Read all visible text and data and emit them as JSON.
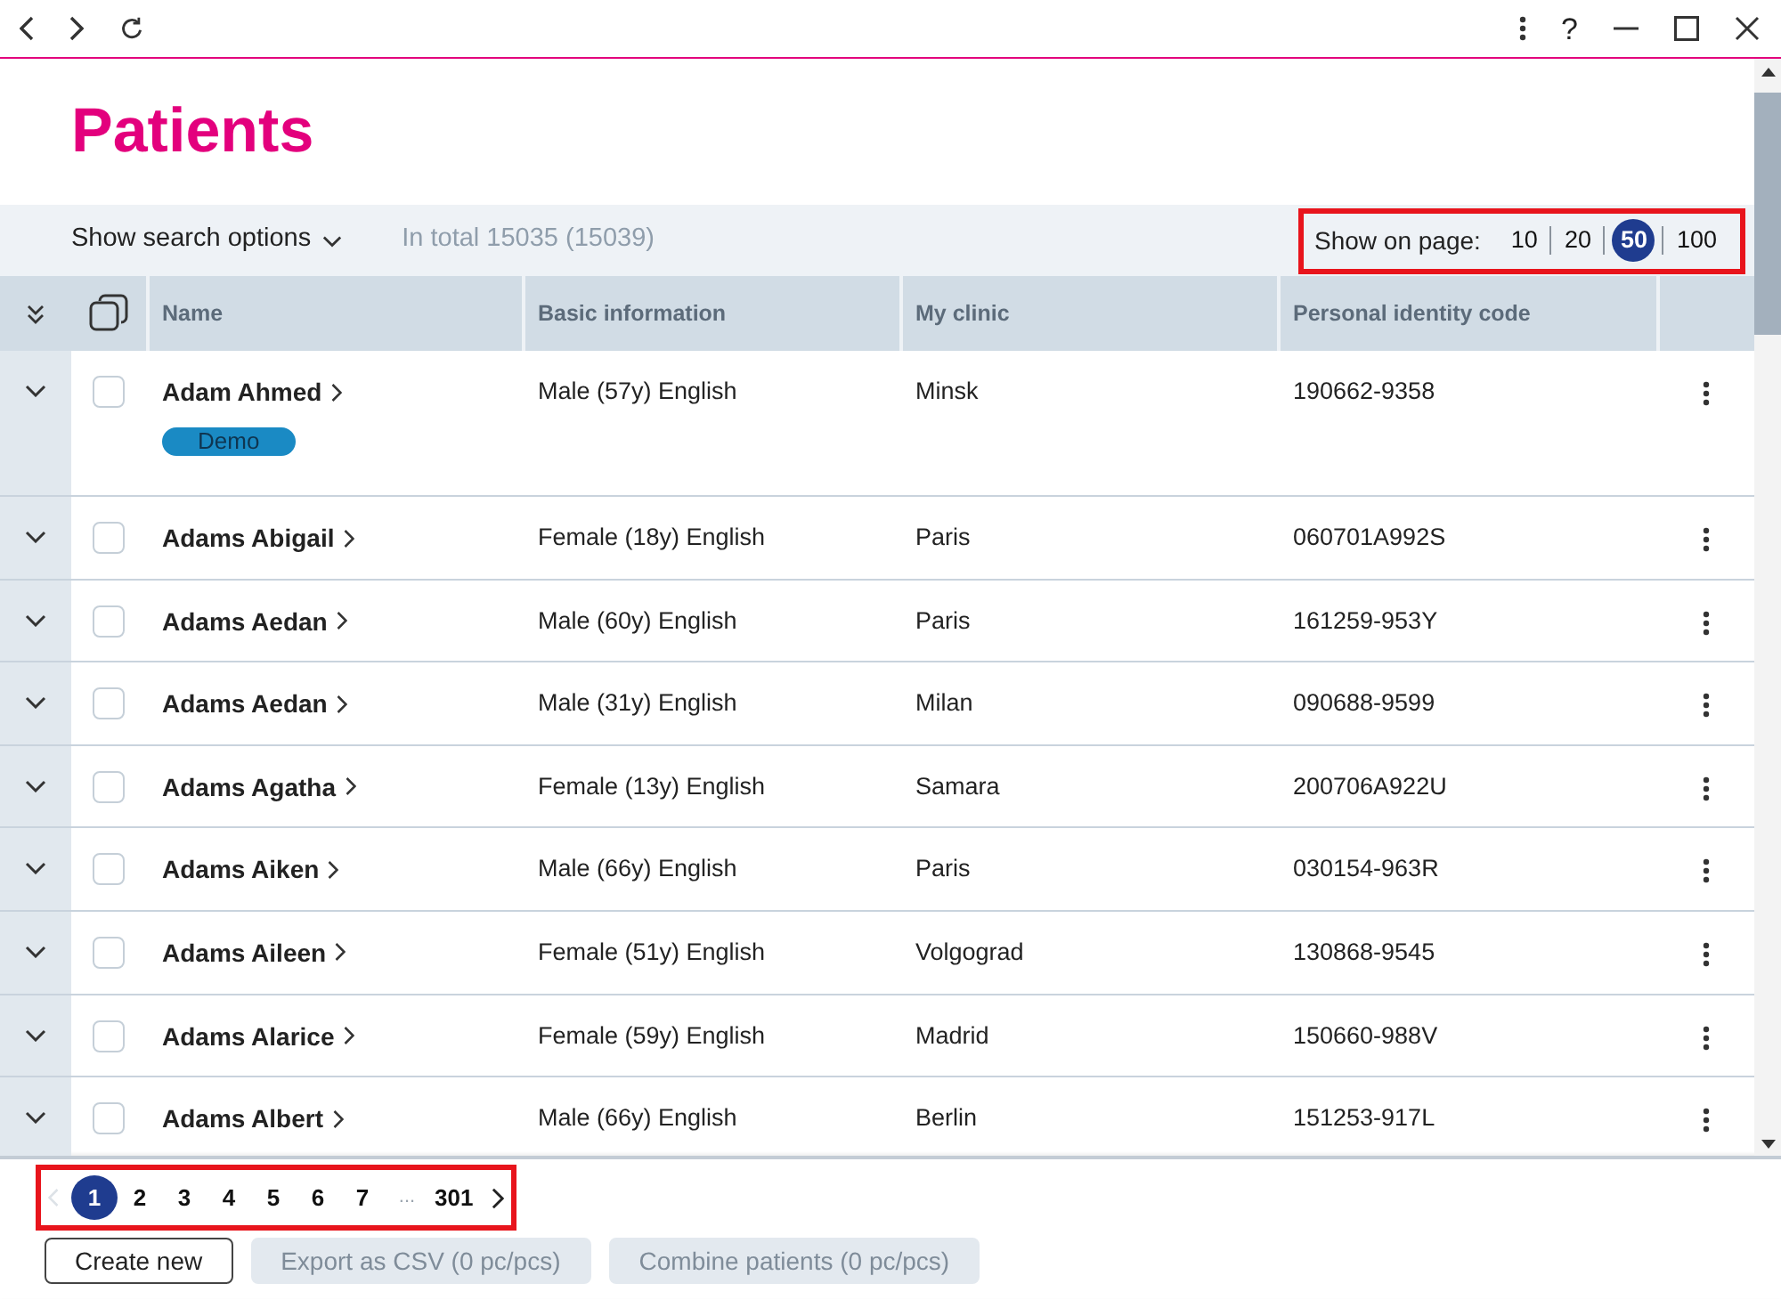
{
  "browser_bar": {
    "help": "?"
  },
  "page": {
    "title": "Patients"
  },
  "toolbar": {
    "search_toggle": "Show search options",
    "total": "In total 15035 (15039)",
    "page_size": {
      "label": "Show on page:",
      "highlighted": true,
      "options": [
        {
          "label": "10",
          "selected": false
        },
        {
          "label": "20",
          "selected": false
        },
        {
          "label": "50",
          "selected": true
        },
        {
          "label": "100",
          "selected": false
        }
      ]
    }
  },
  "table": {
    "columns": [
      "Name",
      "Basic information",
      "My clinic",
      "Personal identity code"
    ],
    "rows": [
      {
        "name": "Adam Ahmed",
        "basic_information": "Male (57y) English",
        "my_clinic": "Minsk",
        "personal_identity_code": "190662-9358",
        "checked": false,
        "tags": [
          "Demo"
        ]
      },
      {
        "name": "Adams Abigail",
        "basic_information": "Female (18y) English",
        "my_clinic": "Paris",
        "personal_identity_code": "060701A992S",
        "checked": false
      },
      {
        "name": "Adams Aedan",
        "basic_information": "Male (60y) English",
        "my_clinic": "Paris",
        "personal_identity_code": "161259-953Y",
        "checked": false
      },
      {
        "name": "Adams Aedan",
        "basic_information": "Male (31y) English",
        "my_clinic": "Milan",
        "personal_identity_code": "090688-9599",
        "checked": false
      },
      {
        "name": "Adams Agatha",
        "basic_information": "Female (13y) English",
        "my_clinic": "Samara",
        "personal_identity_code": "200706A922U",
        "checked": false
      },
      {
        "name": "Adams Aiken",
        "basic_information": "Male (66y) English",
        "my_clinic": "Paris",
        "personal_identity_code": "030154-963R",
        "checked": false
      },
      {
        "name": "Adams Aileen",
        "basic_information": "Female (51y) English",
        "my_clinic": "Volgograd",
        "personal_identity_code": "130868-9545",
        "checked": false
      },
      {
        "name": "Adams Alarice",
        "basic_information": "Female (59y) English",
        "my_clinic": "Madrid",
        "personal_identity_code": "150660-988V",
        "checked": false
      },
      {
        "name": "Adams Albert",
        "basic_information": "Male (66y) English",
        "my_clinic": "Berlin",
        "personal_identity_code": "151253-917L",
        "checked": false
      }
    ]
  },
  "pagination": {
    "highlighted": true,
    "previous": {
      "disabled": true
    },
    "next": {
      "disabled": false
    },
    "items": [
      {
        "kind": "page",
        "label": "1",
        "selected": true
      },
      {
        "kind": "page",
        "label": "2",
        "selected": false
      },
      {
        "kind": "page",
        "label": "3",
        "selected": false
      },
      {
        "kind": "page",
        "label": "4",
        "selected": false
      },
      {
        "kind": "page",
        "label": "5",
        "selected": false
      },
      {
        "kind": "page",
        "label": "6",
        "selected": false
      },
      {
        "kind": "page",
        "label": "7",
        "selected": false
      },
      {
        "kind": "gap",
        "label": "..."
      },
      {
        "kind": "page",
        "label": "301",
        "selected": false
      }
    ]
  },
  "actions": [
    {
      "label": "Create new",
      "disabled": false
    },
    {
      "label": "Export as CSV (0 pc/pcs)",
      "disabled": true
    },
    {
      "label": "Combine patients (0 pc/pcs)",
      "disabled": true
    }
  ]
}
